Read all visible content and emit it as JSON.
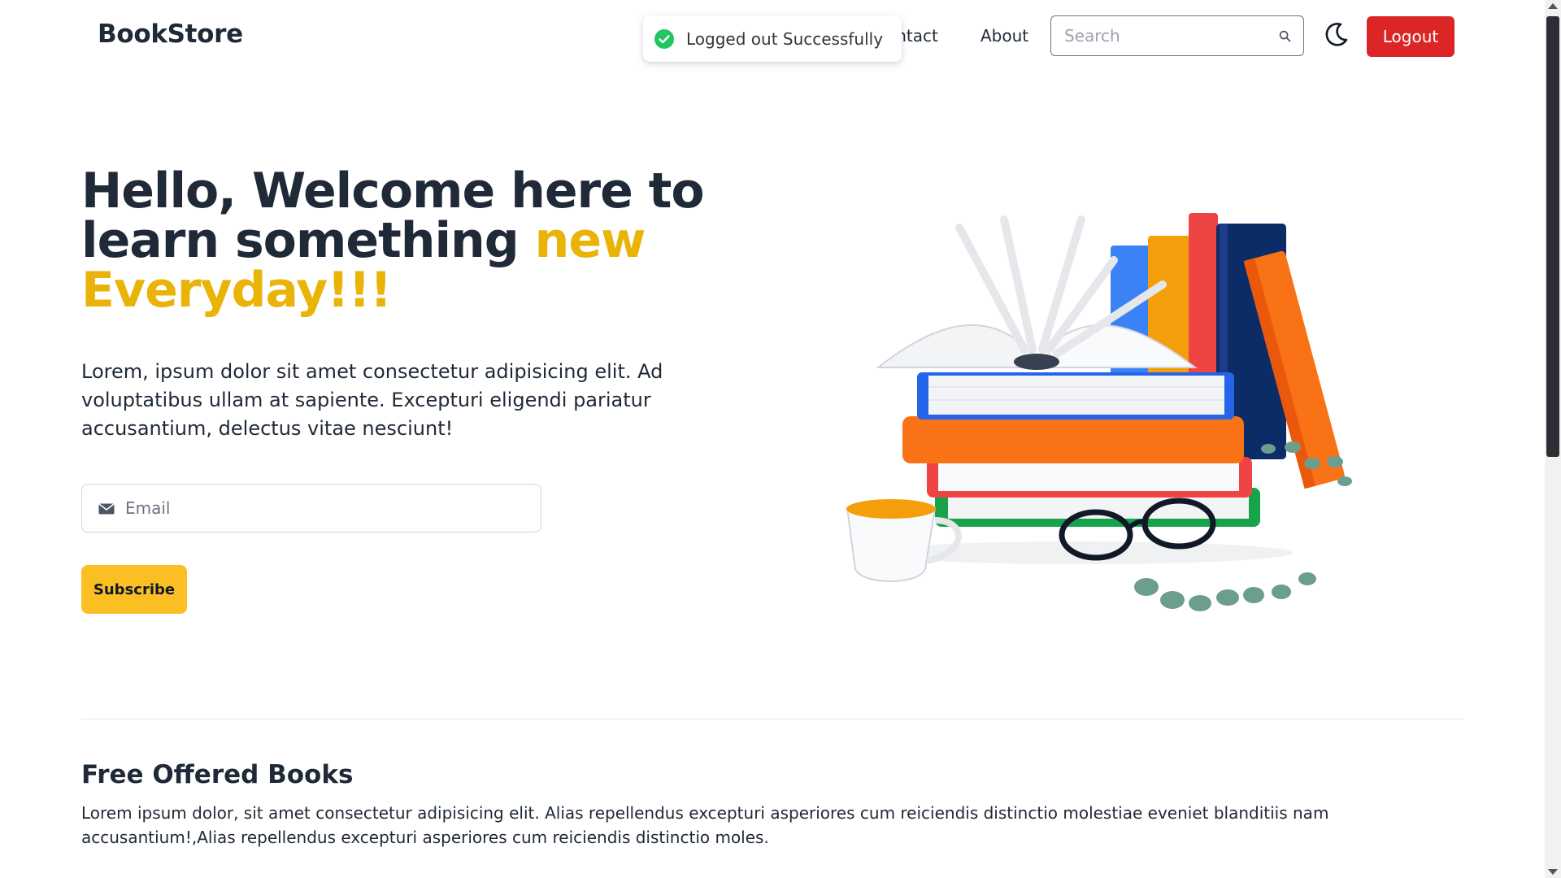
{
  "navbar": {
    "brand": "BookStore",
    "links": [
      "ontact",
      "About"
    ],
    "search_placeholder": "Search",
    "logout_label": "Logout",
    "theme_icon": "moon-icon",
    "search_icon": "search-icon"
  },
  "toast": {
    "message": "Logged out Successfully",
    "icon": "check-circle-icon",
    "color": "#22c55e"
  },
  "hero": {
    "title_part1": "Hello, Welcome here to learn something",
    "title_accent": "new Everyday!!!",
    "description": "Lorem, ipsum dolor sit amet consectetur adipisicing elit. Ad voluptatibus ullam at sapiente. Excepturi eligendi pariatur accusantium, delectus vitae nesciunt!",
    "email_placeholder": "Email",
    "email_icon": "envelope-icon",
    "subscribe_label": "Subscribe"
  },
  "section": {
    "title": "Free Offered Books",
    "description": "Lorem ipsum dolor, sit amet consectetur adipisicing elit. Alias repellendus excepturi asperiores cum reiciendis distinctio molestiae eveniet blanditiis nam accusantium!,Alias repellendus excepturi asperiores cum reiciendis distinctio moles."
  },
  "colors": {
    "accent": "#eab308",
    "logout": "#dc2626",
    "subscribe": "#fbbf24",
    "text": "#1f2937"
  }
}
